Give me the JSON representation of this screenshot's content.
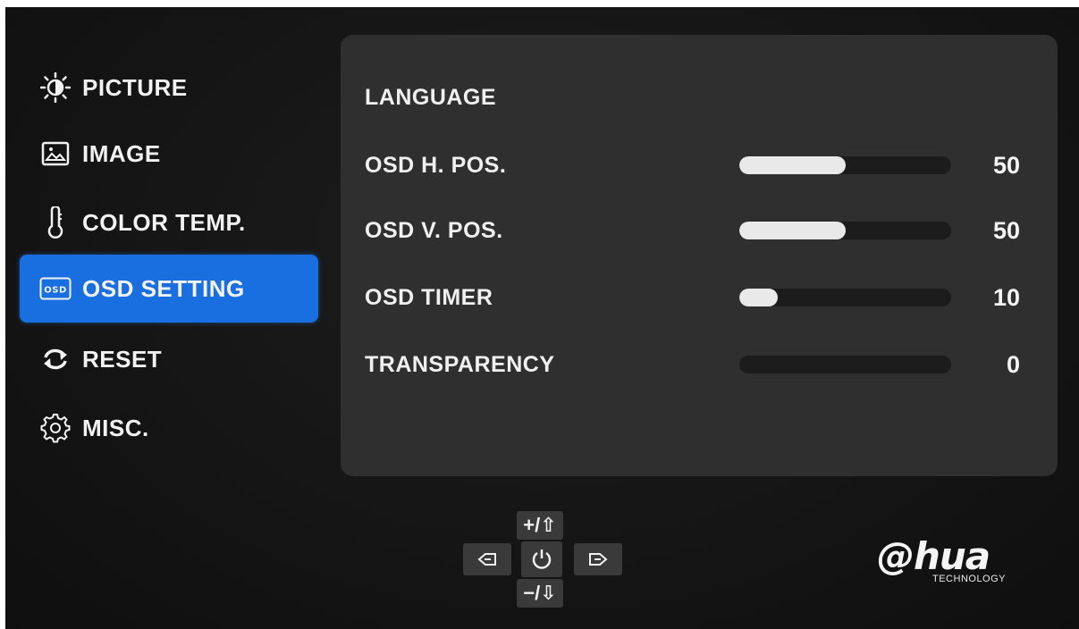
{
  "menu": {
    "items": [
      {
        "label": "PICTURE",
        "icon": "brightness-icon",
        "selected": false
      },
      {
        "label": "IMAGE",
        "icon": "image-icon",
        "selected": false
      },
      {
        "label": "COLOR TEMP.",
        "icon": "thermometer-icon",
        "selected": false
      },
      {
        "label": "OSD SETTING",
        "icon": "osd-icon",
        "selected": true
      },
      {
        "label": "RESET",
        "icon": "reset-icon",
        "selected": false
      },
      {
        "label": "MISC.",
        "icon": "gear-icon",
        "selected": false
      }
    ]
  },
  "settings": {
    "language_label": "LANGUAGE",
    "rows": [
      {
        "label": "OSD H. POS.",
        "value": "50",
        "fraction": 0.5
      },
      {
        "label": "OSD V. POS.",
        "value": "50",
        "fraction": 0.5
      },
      {
        "label": "OSD TIMER",
        "value": "10",
        "fraction": 0.18
      },
      {
        "label": "TRANSPARENCY",
        "value": "0",
        "fraction": 0.0
      }
    ]
  },
  "keypad": {
    "up": "+/⇧",
    "down": "−/⇩",
    "left_icon": "enter-left-icon",
    "power_icon": "power-icon",
    "right_icon": "exit-right-icon"
  },
  "logo": {
    "brand": "@hua",
    "tagline": "TECHNOLOGY"
  },
  "colors": {
    "accent": "#1a6fe0",
    "panel": "#2f2f2f",
    "background": "#141414",
    "slider_fill": "#e9e9e9",
    "slider_track": "#1c1c1c"
  }
}
